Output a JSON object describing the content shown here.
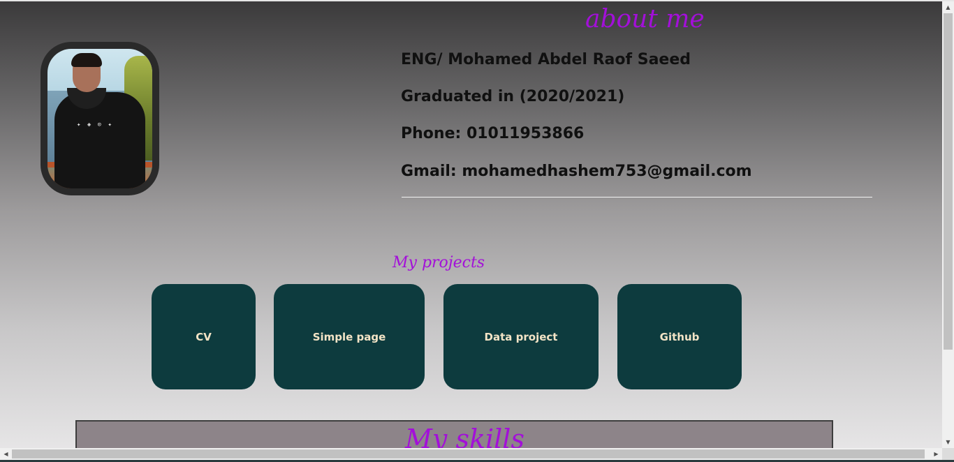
{
  "about": {
    "title": "about me",
    "name": "ENG/ Mohamed Abdel Raof Saeed",
    "graduated": "Graduated in (2020/2021)",
    "phone": "Phone: 01011953866",
    "gmail": "Gmail: mohamedhashem753@gmail.com"
  },
  "projects": {
    "title": "My projects",
    "buttons": [
      {
        "label": "CV"
      },
      {
        "label": "Simple page"
      },
      {
        "label": "Data project"
      },
      {
        "label": "Github"
      }
    ]
  },
  "skills": {
    "title": "My skills"
  },
  "colors": {
    "heading": "#a30fd9",
    "button_bg": "#0d3b3e",
    "button_text": "#f3e4c6",
    "skills_bg": "#8d8489"
  },
  "icons": {
    "scroll_up": "▲",
    "scroll_down": "▼",
    "scroll_left": "◀",
    "scroll_right": "▶"
  }
}
